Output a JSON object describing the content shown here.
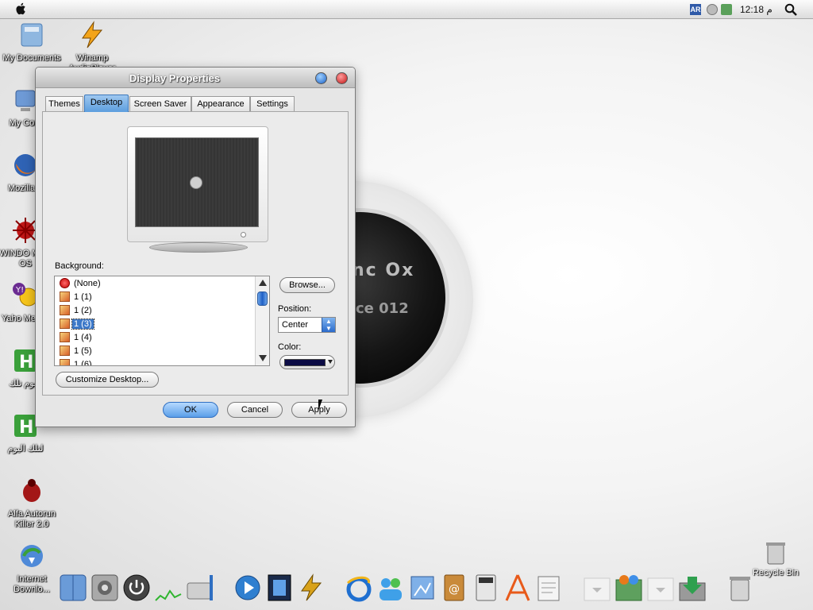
{
  "menubar": {
    "lang_indicator": "AR",
    "clock": "12:18 م"
  },
  "desktop_icons": [
    {
      "label": "My Documents"
    },
    {
      "label": "Winamp AudioPlayer"
    },
    {
      "label": "My Com"
    },
    {
      "label": "Mozilla F"
    },
    {
      "label": "WINDO MAC OS"
    },
    {
      "label": "Yaho Messe"
    },
    {
      "label": "اليوم تلك"
    },
    {
      "label": "لتلك اليوم"
    },
    {
      "label": "Alfa Autorun Killer 2.0"
    },
    {
      "label": "Internet Downlo..."
    },
    {
      "label": "Recycle Bin"
    }
  ],
  "wallpaper": {
    "logo_text_1": "nc Ox",
    "logo_text_2": "ce 012"
  },
  "dialog": {
    "title": "Display Properties",
    "tabs": [
      {
        "label": "Themes"
      },
      {
        "label": "Desktop"
      },
      {
        "label": "Screen Saver"
      },
      {
        "label": "Appearance"
      },
      {
        "label": "Settings"
      }
    ],
    "active_tab": "Desktop",
    "background_label": "Background:",
    "background_items": [
      {
        "label": "(None)"
      },
      {
        "label": "1 (1)"
      },
      {
        "label": "1 (2)"
      },
      {
        "label": "1 (3)"
      },
      {
        "label": "1 (4)"
      },
      {
        "label": "1 (5)"
      },
      {
        "label": "1 (6)"
      }
    ],
    "selected_background": "1 (3)",
    "browse_label": "Browse...",
    "position_label": "Position:",
    "position_value": "Center",
    "color_label": "Color:",
    "color_value": "#0b0b45",
    "customize_label": "Customize Desktop...",
    "ok_label": "OK",
    "cancel_label": "Cancel",
    "apply_label": "Apply"
  },
  "colors": {
    "accent_blue": "#5a9ee8",
    "selection": "#3c78c8",
    "close_red": "#c21515"
  }
}
